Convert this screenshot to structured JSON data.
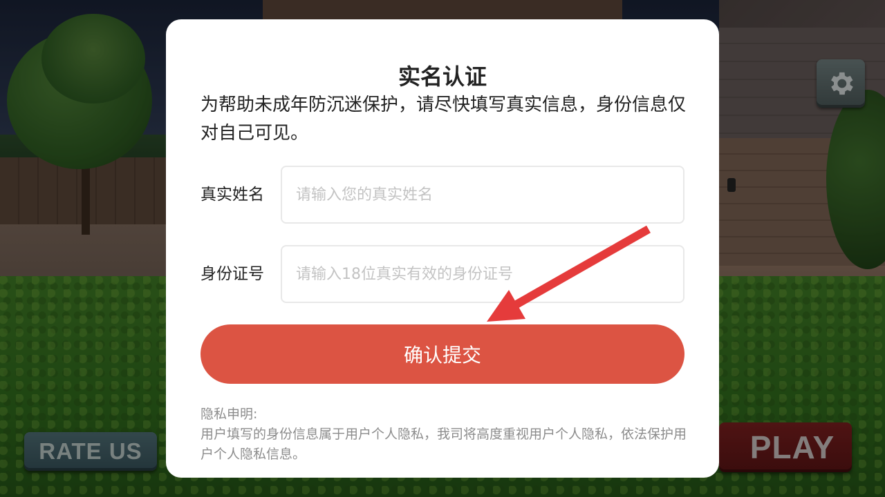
{
  "background": {
    "rate_label": "RATE US",
    "play_label": "PLAY",
    "settings_icon": "gear-icon"
  },
  "dialog": {
    "title": "实名认证",
    "description": "为帮助未成年防沉迷保护，请尽快填写真实信息，身份信息仅对自己可见。",
    "name_field": {
      "label": "真实姓名",
      "placeholder": "请输入您的真实姓名",
      "value": ""
    },
    "id_field": {
      "label": "身份证号",
      "placeholder": "请输入18位真实有效的身份证号",
      "value": ""
    },
    "submit_label": "确认提交",
    "privacy_title": "隐私申明:",
    "privacy_text": "用户填写的身份信息属于用户个人隐私，我司将高度重视用户个人隐私，依法保护用户个人隐私信息。"
  },
  "colors": {
    "accent": "#dc5443",
    "annotation_arrow": "#e53b3b"
  }
}
